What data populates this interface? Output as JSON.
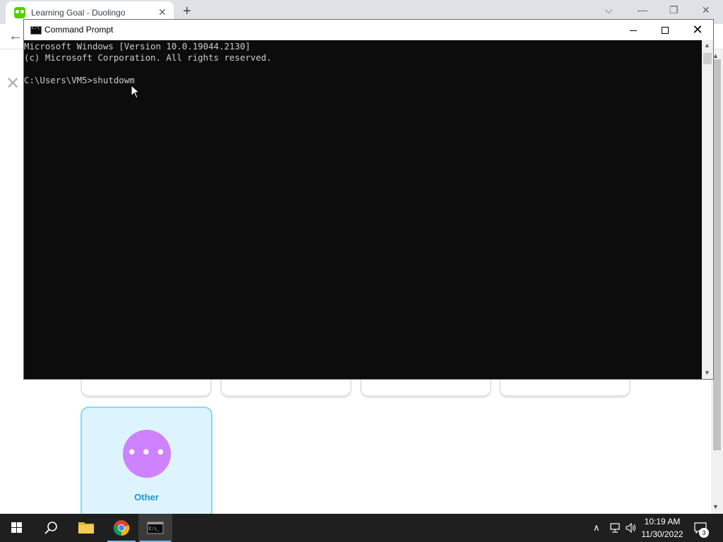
{
  "browser": {
    "tab_title": "Learning Goal - Duolingo",
    "tab_close": "✕",
    "new_tab": "+",
    "controls": {
      "tabsearch": "⌵",
      "minimize": "—",
      "restore": "❐",
      "close": "✕"
    },
    "back_arrow": "←",
    "page_close": "✕"
  },
  "goal_options": {
    "other_label": "Other",
    "other_dots": "• • •",
    "other_color": "#ce82ff"
  },
  "cmd": {
    "title": "Command Prompt",
    "close_glyph": "✕",
    "lines": [
      "Microsoft Windows [Version 10.0.19044.2130]",
      "(c) Microsoft Corporation. All rights reserved.",
      "",
      "C:\\Users\\VM5>shutdowm"
    ],
    "scroll_up": "▲",
    "scroll_down": "▼"
  },
  "page_scroll": {
    "up": "▲",
    "down": "▼"
  },
  "taskbar": {
    "time": "10:19 AM",
    "date": "11/30/2022",
    "notification_count": "3",
    "tray": {
      "chevron": "∧",
      "network": "⊡",
      "volume": "🔈"
    }
  }
}
